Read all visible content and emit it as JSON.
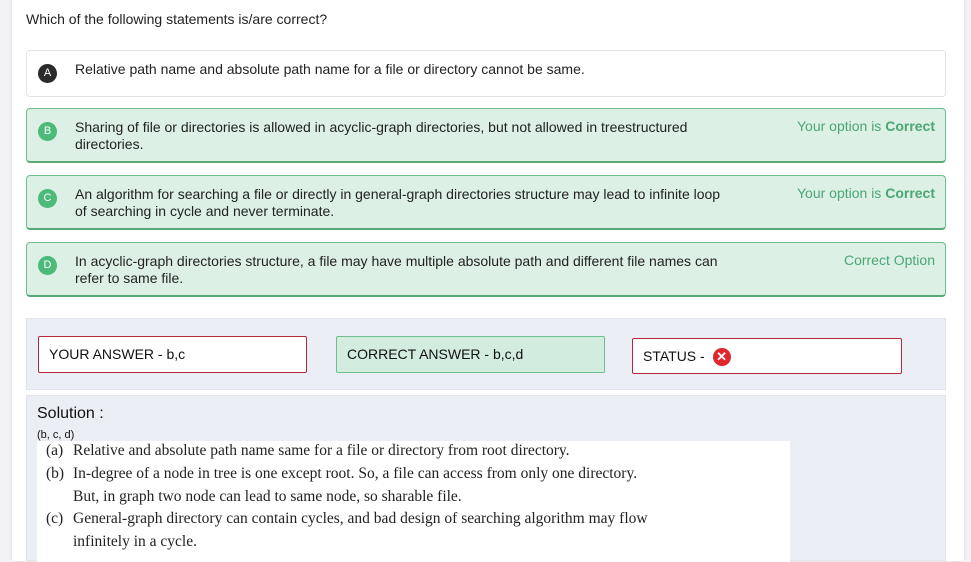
{
  "question": "Which of the following statements is/are correct?",
  "options": [
    {
      "letter": "A",
      "text": "Relative path name and absolute path name for a file or directory cannot be same.",
      "status_prefix": "",
      "status_strong": ""
    },
    {
      "letter": "B",
      "text": "Sharing of file or directories is allowed in acyclic-graph directories, but not allowed in treestructured directories.",
      "status_prefix": "Your option is ",
      "status_strong": "Correct"
    },
    {
      "letter": "C",
      "text": "An algorithm for searching a file or directly in general-graph directories structure may lead to infinite loop of searching in cycle and never terminate.",
      "status_prefix": "Your option is ",
      "status_strong": "Correct"
    },
    {
      "letter": "D",
      "text": "In acyclic-graph directories structure, a file may have multiple absolute path and different file names can refer to same file.",
      "status_prefix": "Correct Option",
      "status_strong": ""
    }
  ],
  "answers": {
    "yours": "YOUR ANSWER - b,c",
    "correct": "CORRECT ANSWER - b,c,d",
    "status_label": "STATUS - ",
    "status_icon": "close-icon"
  },
  "solution": {
    "title": "Solution :",
    "tag": "(b, c, d)",
    "lines": [
      {
        "label": "(a)",
        "text": "Relative and absolute path name same for a file or directory from root directory."
      },
      {
        "label": "(b)",
        "text": "In-degree of a node in tree is one except root. So, a file can access from only one directory."
      },
      {
        "label": "",
        "text": "But, in graph two node can lead to same node, so sharable file."
      },
      {
        "label": "(c)",
        "text": "General-graph directory can contain cycles, and bad design of searching algorithm may flow"
      },
      {
        "label": "",
        "text": "infinitely in a cycle."
      }
    ]
  },
  "colors": {
    "correct_bg": "#dcf0e6",
    "correct_accent": "#4cba79",
    "wrong_border": "#b3283b",
    "status_icon": "#e0262d"
  }
}
